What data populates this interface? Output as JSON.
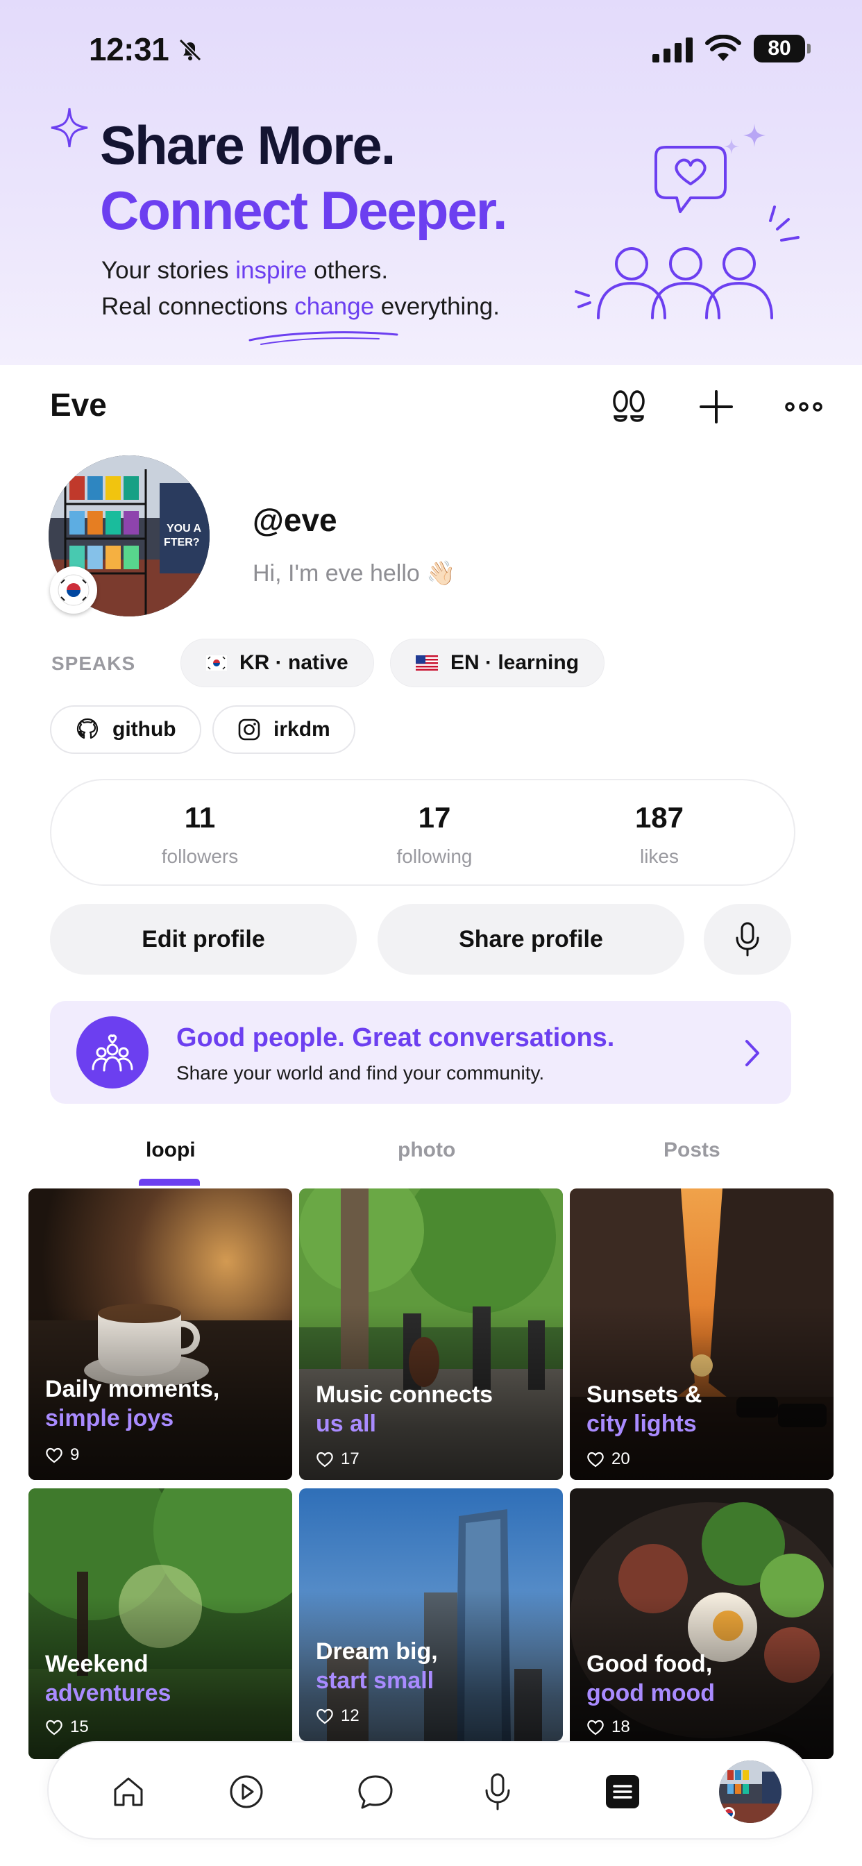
{
  "status_bar": {
    "time": "12:31",
    "battery": "80",
    "icons": [
      "bell-slash-icon",
      "cellular-signal-icon",
      "wifi-icon",
      "battery-icon"
    ]
  },
  "hero": {
    "line1": "Share More.",
    "line2": "Connect Deeper.",
    "sub1": {
      "a": "Your stories ",
      "b": "inspire",
      "c": " others."
    },
    "sub2": {
      "a": "Real connections ",
      "b": "change",
      "c": " everything."
    },
    "accent_color": "#6c3ff0"
  },
  "profile": {
    "name": "Eve",
    "handle": "@eve",
    "bio": "Hi, I'm eve hello 👋🏻",
    "header_icons": [
      "footprints-icon",
      "plus-icon",
      "more-icon"
    ],
    "speaks_label": "SPEAKS",
    "languages": [
      {
        "label": "KR · native",
        "flag": "kr-flag-icon"
      },
      {
        "label": "EN · learning",
        "flag": "us-flag-icon"
      }
    ],
    "links": [
      {
        "label": "github",
        "icon": "github-icon"
      },
      {
        "label": "irkdm",
        "icon": "instagram-icon"
      }
    ]
  },
  "stats": [
    {
      "value": "11",
      "label": "followers"
    },
    {
      "value": "17",
      "label": "following"
    },
    {
      "value": "187",
      "label": "likes"
    }
  ],
  "actions": {
    "edit": "Edit profile",
    "share": "Share profile",
    "mic_icon": "microphone-icon"
  },
  "banner": {
    "title": "Good people. Great conversations.",
    "subtitle": "Share your world and find your community."
  },
  "tabs": [
    "loopi",
    "photo",
    "Posts"
  ],
  "active_tab": "loopi",
  "posts": [
    {
      "line1": "Daily moments,",
      "line2": "simple joys",
      "likes": "9"
    },
    {
      "line1": "Music connects",
      "line2": "us all",
      "likes": "17"
    },
    {
      "line1": "Sunsets &",
      "line2": "city lights",
      "likes": "20"
    },
    {
      "line1": "Weekend",
      "line2": "adventures",
      "likes": "15"
    },
    {
      "line1": "Dream big,",
      "line2": "start small",
      "likes": "12"
    },
    {
      "line1": "Good food,",
      "line2": "good mood",
      "likes": "18"
    }
  ],
  "nav": [
    "home-icon",
    "play-icon",
    "chat-icon",
    "microphone-icon",
    "menu-icon",
    "profile-avatar"
  ]
}
